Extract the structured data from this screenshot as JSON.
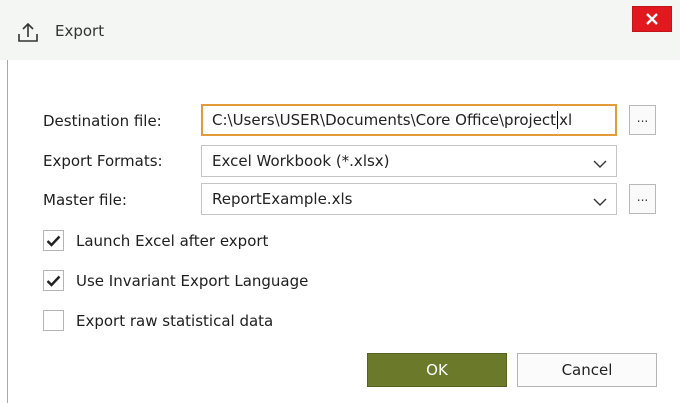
{
  "dialog": {
    "title": "Export",
    "title_icon": "upload-icon",
    "close_icon": "close-icon"
  },
  "form": {
    "destination": {
      "label": "Destination file:",
      "value_before_caret": "C:\\Users\\USER\\Documents\\Core Office\\project",
      "value_after_caret": "xl",
      "browse_label": "..."
    },
    "export_formats": {
      "label": "Export Formats:",
      "selected": "Excel Workbook (*.xlsx)"
    },
    "master_file": {
      "label": "Master file:",
      "selected": "ReportExample.xls",
      "browse_label": "..."
    }
  },
  "options": [
    {
      "label": "Launch Excel after export",
      "checked": true
    },
    {
      "label": "Use Invariant Export Language",
      "checked": true
    },
    {
      "label": "Export raw statistical data",
      "checked": false
    }
  ],
  "buttons": {
    "ok": "OK",
    "cancel": "Cancel"
  },
  "colors": {
    "accent_focus": "#e39a3a",
    "ok_button": "#6b7a2a",
    "close_button": "#e1191e"
  }
}
